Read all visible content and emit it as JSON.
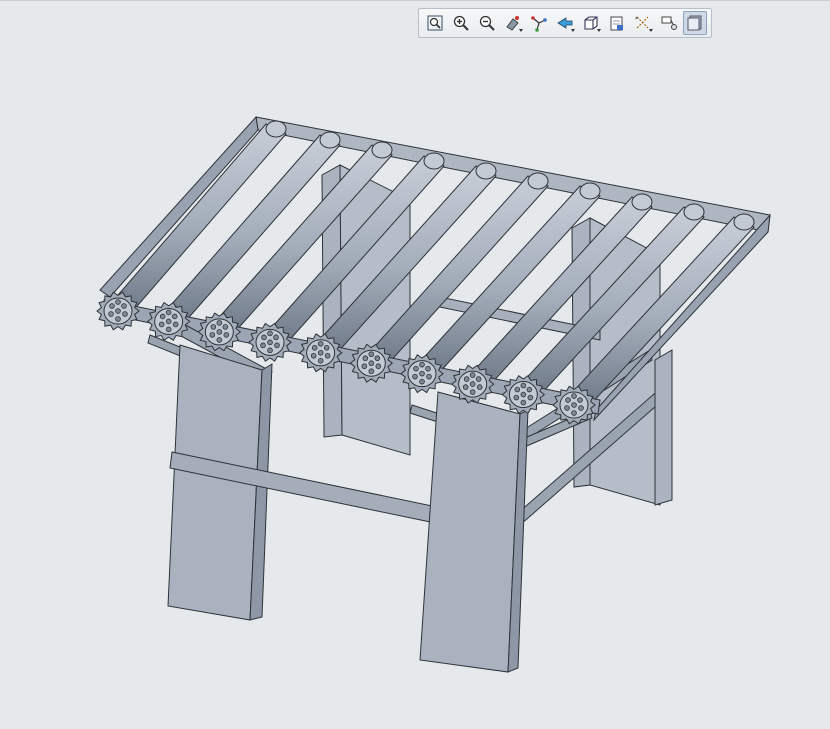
{
  "toolbar": {
    "buttons": [
      {
        "icon": "refit-icon",
        "active": false
      },
      {
        "icon": "zoom-in-icon",
        "active": false
      },
      {
        "icon": "zoom-out-icon",
        "active": false
      },
      {
        "icon": "repaint-icon",
        "active": false,
        "menu": true
      },
      {
        "icon": "spin-center-icon",
        "active": false
      },
      {
        "icon": "orient-mode-icon",
        "active": false,
        "menu": true
      },
      {
        "icon": "saved-views-icon",
        "active": false,
        "menu": true
      },
      {
        "icon": "view-manager-icon",
        "active": false
      },
      {
        "icon": "datum-display-icon",
        "active": false,
        "menu": true
      },
      {
        "icon": "annotation-display-icon",
        "active": false
      },
      {
        "icon": "shading-icon",
        "active": true
      }
    ]
  },
  "colors": {
    "background": "#e6e9ec",
    "model_fill": "#a3adba",
    "model_dark": "#7d8896",
    "model_light": "#c3cad4",
    "edge": "#2e3238"
  },
  "model": {
    "roller_count": 10,
    "sprocket_count": 10
  }
}
